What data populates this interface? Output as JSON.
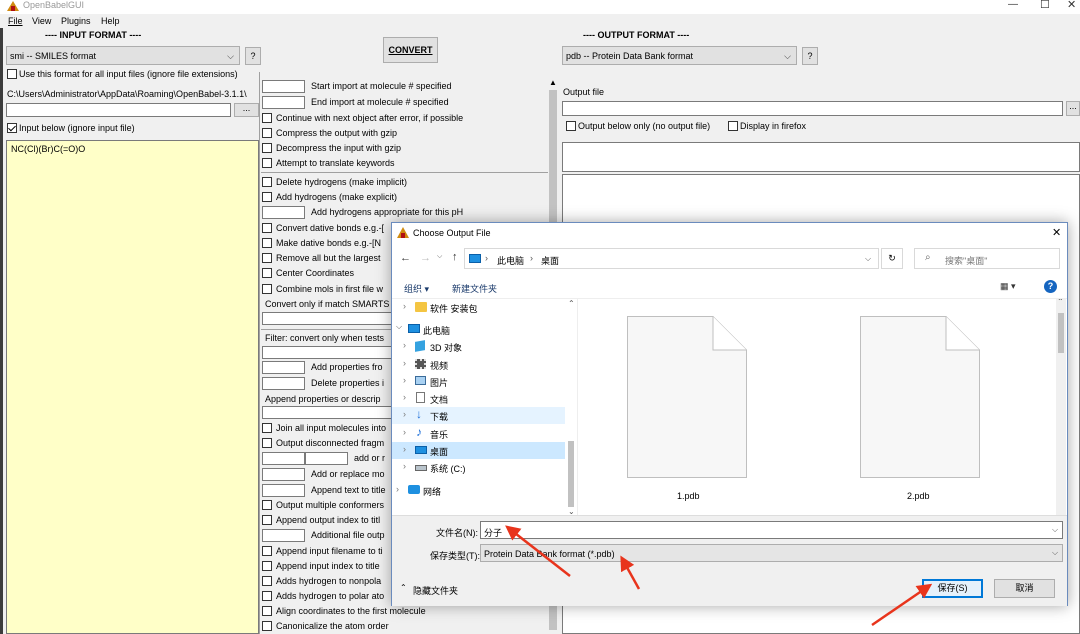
{
  "window": {
    "title": "OpenBabelGUI",
    "menu": [
      "File",
      "View",
      "Plugins",
      "Help"
    ]
  },
  "input": {
    "header": "---- INPUT FORMAT ----",
    "format_value": "smi -- SMILES format",
    "help_label": "?",
    "use_all_label": "Use this format for all input files (ignore file extensions)",
    "path": "C:\\Users\\Administrator\\AppData\\Roaming\\OpenBabel-3.1.1\\",
    "browse_label": "...",
    "input_below_label": "Input below (ignore input file)",
    "smiles_text": "NC(Cl)(Br)C(=O)O"
  },
  "convert": {
    "label": "CONVERT"
  },
  "options": {
    "start_import": "Start import at molecule # specified",
    "end_import": "End import at molecule # specified",
    "continue_error": "Continue with next object after error, if possible",
    "compress_gzip": "Compress the output with gzip",
    "decompress_gzip": "Decompress the input with gzip",
    "translate_keywords": "Attempt to translate keywords",
    "delete_h": "Delete hydrogens (make implicit)",
    "add_h": "Add hydrogens (make explicit)",
    "add_h_ph": "Add hydrogens appropriate for this pH",
    "convert_dative": "Convert dative bonds e.g.-[",
    "make_dative": "Make dative bonds e.g.-[N",
    "remove_largest": "Remove all but the largest",
    "center_coords": "Center Coordinates",
    "combine_mols": "Combine mols in first file w",
    "convert_smarts": "Convert only if match SMARTS",
    "filter_tests": "Filter: convert only when tests",
    "add_props": "Add properties fro",
    "delete_props": "Delete properties i",
    "append_props": "Append properties or descrip",
    "join_all": "Join all input molecules into",
    "output_disconnected": "Output disconnected fragm",
    "add_or_r": "add or r",
    "add_replace": "Add or replace mo",
    "append_title": "Append text to title",
    "output_conformers": "Output multiple conformers",
    "append_index_title": "Append output index to titl",
    "additional_file": "Additional file outp",
    "append_filename": "Append input filename to ti",
    "append_input_index": "Append input index to title",
    "add_h_nonpolar": "Adds hydrogen to nonpola",
    "add_h_polar": "Adds hydrogen to polar ato",
    "align_coords": "Align coordinates to the first molecule",
    "canonicalize": "Canonicalize the atom order"
  },
  "output": {
    "header": "---- OUTPUT FORMAT ----",
    "format_value": "pdb -- Protein Data Bank format",
    "help_label": "?",
    "file_label": "Output file",
    "browse_label": "...",
    "output_below_label": "Output below only (no output file)",
    "firefox_label": "Display in firefox"
  },
  "dialog": {
    "title": "Choose Output File",
    "close": "✕",
    "crumbs": [
      "此电脑",
      "桌面"
    ],
    "refresh": "↻",
    "search_placeholder": "搜索\"桌面\"",
    "organize": "组织 ▾",
    "new_folder": "新建文件夹",
    "view_icon": "▦ ▾",
    "help_icon": "?",
    "tree": [
      {
        "label": "软件 安装包",
        "icon": "folder"
      },
      {
        "label": "此电脑",
        "icon": "pc"
      },
      {
        "label": "3D 对象",
        "icon": "3d"
      },
      {
        "label": "视频",
        "icon": "video"
      },
      {
        "label": "图片",
        "icon": "pic"
      },
      {
        "label": "文档",
        "icon": "doc"
      },
      {
        "label": "下载",
        "icon": "download"
      },
      {
        "label": "音乐",
        "icon": "music"
      },
      {
        "label": "桌面",
        "icon": "desktop"
      },
      {
        "label": "系统 (C:)",
        "icon": "drive"
      },
      {
        "label": "网络",
        "icon": "net"
      }
    ],
    "files": [
      {
        "name": "1.pdb"
      },
      {
        "name": "2.pdb"
      }
    ],
    "filename_label": "文件名(N):",
    "filename_value": "分子",
    "filetype_label": "保存类型(T):",
    "filetype_value": "Protein Data Bank format (*.pdb)",
    "hide_folders": "隐藏文件夹",
    "save": "保存(S)",
    "cancel": "取消",
    "colors": {
      "accent": "#0078d7",
      "selected": "#cce8ff",
      "arrow": "#e8341c"
    }
  }
}
